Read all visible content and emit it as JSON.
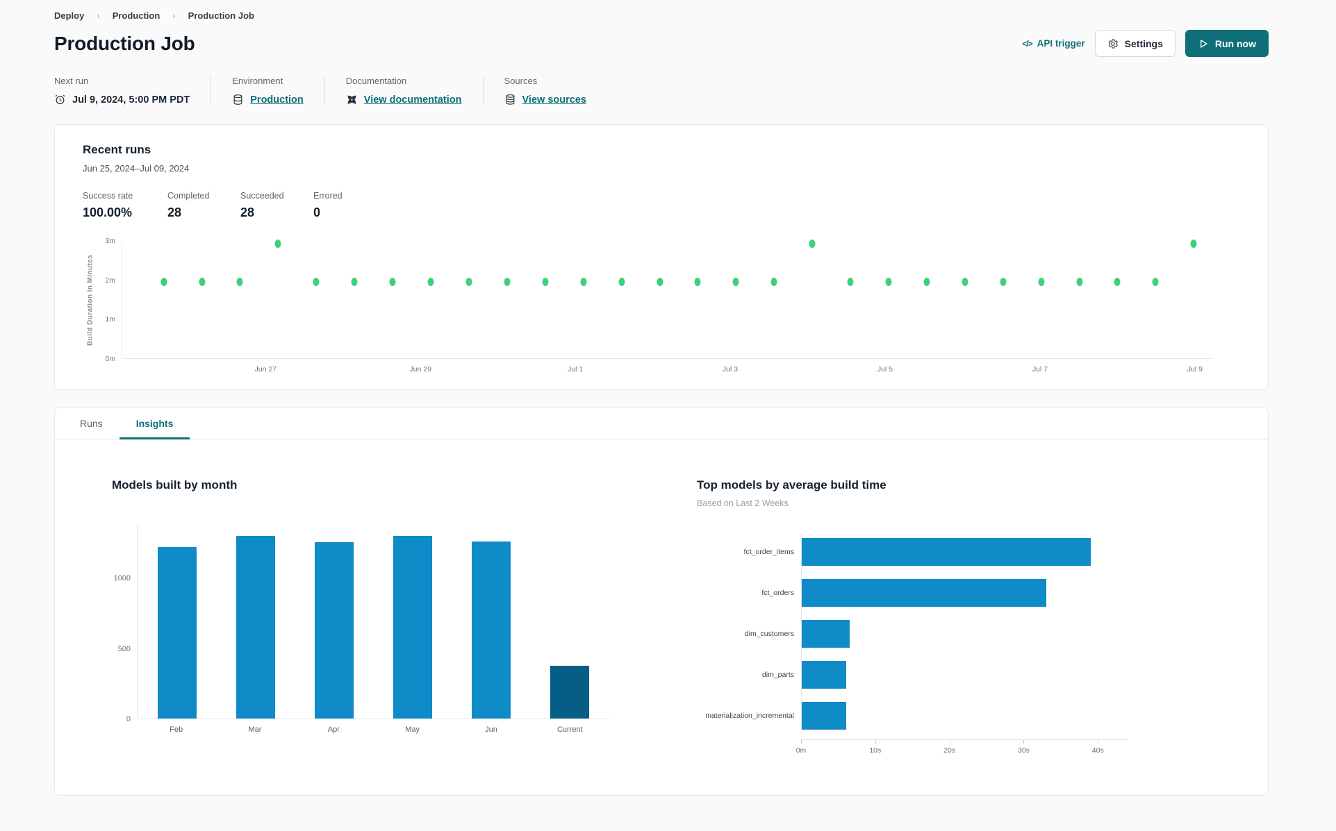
{
  "breadcrumb": {
    "items": [
      "Deploy",
      "Production",
      "Production Job"
    ]
  },
  "header": {
    "title": "Production Job",
    "api_trigger_label": "API trigger",
    "api_trigger_glyph": "</>",
    "settings_label": "Settings",
    "run_now_label": "Run now"
  },
  "meta": {
    "next_run": {
      "label": "Next run",
      "value": "Jul 9, 2024, 5:00 PM PDT"
    },
    "environment": {
      "label": "Environment",
      "value": "Production"
    },
    "documentation": {
      "label": "Documentation",
      "value": "View documentation"
    },
    "sources": {
      "label": "Sources",
      "value": "View sources"
    }
  },
  "recent_runs": {
    "title": "Recent runs",
    "date_range": "Jun 25, 2024–Jul 09, 2024",
    "stats": [
      {
        "label": "Success rate",
        "value": "100.00%"
      },
      {
        "label": "Completed",
        "value": "28"
      },
      {
        "label": "Succeeded",
        "value": "28"
      },
      {
        "label": "Errored",
        "value": "0"
      }
    ]
  },
  "tabs": [
    {
      "label": "Runs",
      "active": false
    },
    {
      "label": "Insights",
      "active": true
    }
  ],
  "colors": {
    "accent_teal": "#0e6f78",
    "run_dot_green": "#3fd07b",
    "bar_blue": "#0f8bc7",
    "bar_dark_blue": "#065d86"
  },
  "chart_data": [
    {
      "type": "scatter",
      "name": "recent-run-durations",
      "ylabel": "Build Duration in Minutes",
      "yticks": [
        "0m",
        "1m",
        "2m",
        "3m"
      ],
      "ylim": [
        0,
        3
      ],
      "xticks": [
        "Jun 27",
        "Jun 29",
        "Jul 1",
        "Jul 3",
        "Jul 5",
        "Jul 7",
        "Jul 9"
      ],
      "points_minutes": [
        1.95,
        1.95,
        1.95,
        2.93,
        1.95,
        1.95,
        1.95,
        1.95,
        1.95,
        1.95,
        1.95,
        1.95,
        1.95,
        1.95,
        1.95,
        1.95,
        1.95,
        2.93,
        1.95,
        1.95,
        1.95,
        1.95,
        1.95,
        1.95,
        1.95,
        1.95,
        1.95,
        2.93
      ],
      "point_color": "#3fd07b",
      "grid": false
    },
    {
      "type": "bar",
      "title": "Models built by month",
      "categories": [
        "Feb",
        "Mar",
        "Apr",
        "May",
        "Jun",
        "Current"
      ],
      "values": [
        1220,
        1300,
        1255,
        1300,
        1260,
        375
      ],
      "yticks": [
        0,
        500,
        1000
      ],
      "ylim": [
        0,
        1380
      ],
      "bar_color": "#0f8bc7",
      "highlight_index": 5,
      "highlight_color": "#065d86",
      "grid": false
    },
    {
      "type": "bar-horizontal",
      "title": "Top models by average build time",
      "subtitle": "Based on Last 2 Weeks",
      "categories": [
        "fct_order_items",
        "fct_orders",
        "dim_customers",
        "dim_parts",
        "materialization_incremental"
      ],
      "values_seconds": [
        39,
        33,
        6.5,
        6,
        6
      ],
      "xtick_labels": [
        "0m",
        "10s",
        "20s",
        "30s",
        "40s"
      ],
      "xtick_values": [
        0,
        10,
        20,
        30,
        40
      ],
      "xlim": [
        0,
        44
      ],
      "bar_color": "#0f8bc7",
      "grid": false
    }
  ]
}
